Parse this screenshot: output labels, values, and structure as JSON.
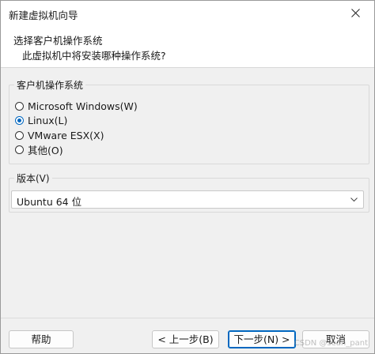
{
  "window": {
    "title": "新建虚拟机向导"
  },
  "header": {
    "title": "选择客户机操作系统",
    "subtitle": "此虚拟机中将安装哪种操作系统?"
  },
  "os_group": {
    "legend": "客户机操作系统",
    "options": [
      {
        "label": "Microsoft Windows(W)",
        "checked": false
      },
      {
        "label": "Linux(L)",
        "checked": true
      },
      {
        "label": "VMware ESX(X)",
        "checked": false
      },
      {
        "label": "其他(O)",
        "checked": false
      }
    ]
  },
  "version_group": {
    "legend": "版本(V)",
    "selected": "Ubuntu 64 位"
  },
  "footer": {
    "help": "帮助",
    "back": "< 上一步(B)",
    "next": "下一步(N) >",
    "cancel": "取消"
  },
  "watermark": "CSDN @sean_pant",
  "colors": {
    "accent": "#0067c0",
    "dialog_bg": "#f0f0f0"
  }
}
